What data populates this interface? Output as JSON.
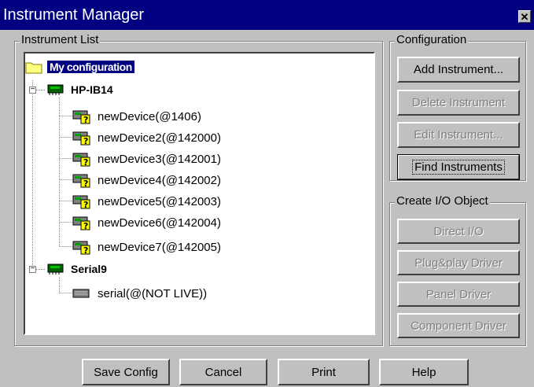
{
  "window": {
    "title": "Instrument Manager",
    "close_glyph": "✕"
  },
  "instrument_list": {
    "group_label": "Instrument List",
    "tree": {
      "root": {
        "label": "My configuration",
        "icon": "folder-icon"
      },
      "nodes": [
        {
          "label": "HP-IB14",
          "icon": "bus-card-icon",
          "expanded": true,
          "children": [
            {
              "label": "newDevice(@1406)",
              "icon": "unknown-device-icon"
            },
            {
              "label": "newDevice2(@142000)",
              "icon": "unknown-device-icon"
            },
            {
              "label": "newDevice3(@142001)",
              "icon": "unknown-device-icon"
            },
            {
              "label": "newDevice4(@142002)",
              "icon": "unknown-device-icon"
            },
            {
              "label": "newDevice5(@142003)",
              "icon": "unknown-device-icon"
            },
            {
              "label": "newDevice6(@142004)",
              "icon": "unknown-device-icon"
            },
            {
              "label": "newDevice7(@142005)",
              "icon": "unknown-device-icon"
            }
          ]
        },
        {
          "label": "Serial9",
          "icon": "bus-card-icon",
          "expanded": true,
          "children": [
            {
              "label": "serial(@(NOT LIVE))",
              "icon": "serial-device-icon"
            }
          ]
        }
      ]
    }
  },
  "configuration": {
    "group_label": "Configuration",
    "buttons": [
      {
        "label": "Add Instrument...",
        "enabled": true
      },
      {
        "label": "Delete Instrument",
        "enabled": false
      },
      {
        "label": "Edit Instrument...",
        "enabled": false
      },
      {
        "label": "Find Instruments",
        "enabled": true,
        "focused": true
      }
    ]
  },
  "create_io": {
    "group_label": "Create I/O Object",
    "buttons": [
      {
        "label": "Direct I/O",
        "enabled": false
      },
      {
        "label": "Plug&play Driver",
        "enabled": false
      },
      {
        "label": "Panel Driver",
        "enabled": false
      },
      {
        "label": "Component Driver",
        "enabled": false
      }
    ]
  },
  "footer": {
    "buttons": [
      {
        "label": "Save Config"
      },
      {
        "label": "Cancel"
      },
      {
        "label": "Print"
      },
      {
        "label": "Help"
      }
    ]
  },
  "colors": {
    "titlebar": "#000080",
    "face": "#c0c0c0",
    "selection": "#000080",
    "disabled_text": "#808080"
  }
}
